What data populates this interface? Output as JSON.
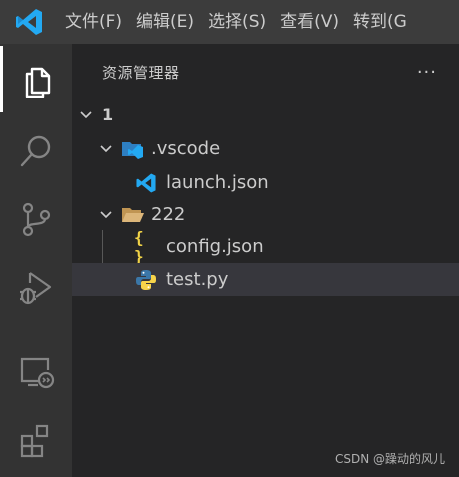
{
  "menu": {
    "logo_icon": "vscode-logo-icon",
    "items": [
      {
        "label": "文件(F)"
      },
      {
        "label": "编辑(E)"
      },
      {
        "label": "选择(S)"
      },
      {
        "label": "查看(V)"
      },
      {
        "label": "转到(G"
      }
    ]
  },
  "activitybar": {
    "items": [
      {
        "icon": "explorer-icon",
        "active": true
      },
      {
        "icon": "search-icon",
        "active": false
      },
      {
        "icon": "source-control-icon",
        "active": false
      },
      {
        "icon": "run-debug-icon",
        "active": false
      },
      {
        "icon": "remote-explorer-icon",
        "active": false
      },
      {
        "icon": "extensions-icon",
        "active": false
      }
    ]
  },
  "sidebar": {
    "title": "资源管理器",
    "more_label": "···",
    "tree": [
      {
        "label": "1",
        "kind": "root",
        "expanded": true
      },
      {
        "label": ".vscode",
        "kind": "folder",
        "expanded": true
      },
      {
        "label": "launch.json",
        "kind": "file",
        "icon": "vscode-file-icon"
      },
      {
        "label": "222",
        "kind": "folder",
        "expanded": true
      },
      {
        "label": "config.json",
        "kind": "file",
        "icon": "json-icon"
      },
      {
        "label": "test.py",
        "kind": "file",
        "icon": "python-icon",
        "selected": true
      }
    ]
  },
  "watermark": "CSDN @躁动的风儿",
  "colors": {
    "titlebar": "#3c3c3c",
    "activitybar": "#333333",
    "sidebar": "#252526",
    "selection": "#37373d",
    "vscode_blue": "#23a9f2",
    "folder": "#dcb67a",
    "json_yellow": "#f1d347"
  }
}
